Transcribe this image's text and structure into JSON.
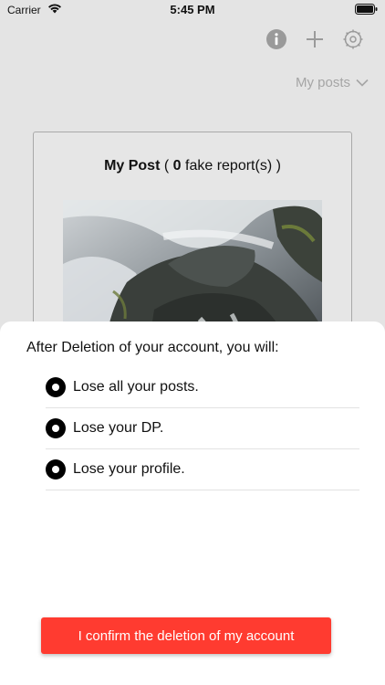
{
  "status_bar": {
    "carrier": "Carrier",
    "time": "5:45 PM",
    "wifi_icon": "wifi-icon",
    "battery_icon": "battery-icon"
  },
  "toolbar": {
    "icons": [
      "info-icon",
      "add-icon",
      "settings-icon"
    ]
  },
  "filter": {
    "label": "My posts",
    "icon": "chevron-down-icon"
  },
  "post": {
    "title": "My Post",
    "count": "0",
    "suffix": "fake report(s)",
    "open_paren": "(",
    "close_paren": ")"
  },
  "sheet": {
    "heading": "After Deletion of your account, you will:",
    "items": [
      {
        "label": "Lose all your posts."
      },
      {
        "label": "Lose your DP."
      },
      {
        "label": "Lose your profile."
      }
    ],
    "confirm_label": "I confirm the deletion of my account"
  },
  "colors": {
    "accent": "#ff3b30",
    "background": "#e4e4e4",
    "muted": "#a5a5a5"
  }
}
